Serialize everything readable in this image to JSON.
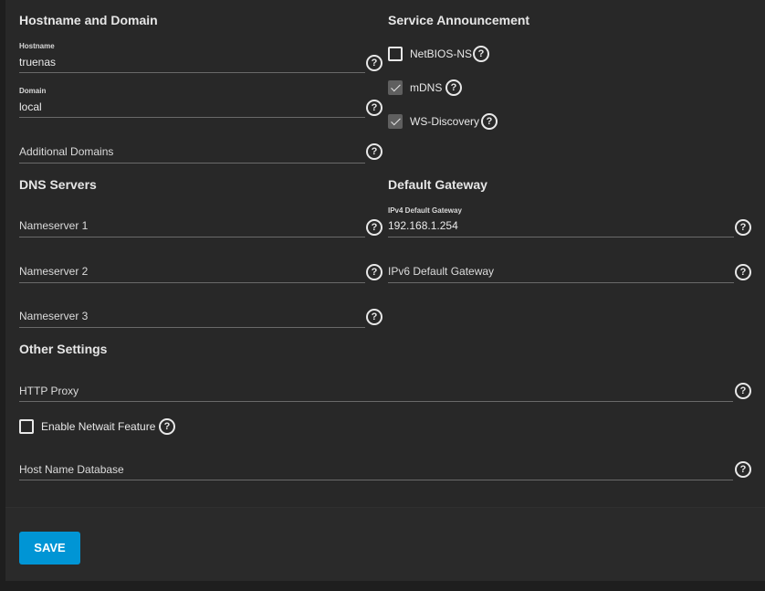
{
  "sections": {
    "hostname_domain": "Hostname and Domain",
    "service_announcement": "Service Announcement",
    "dns_servers": "DNS Servers",
    "default_gateway": "Default Gateway",
    "other_settings": "Other Settings"
  },
  "hostname": {
    "label": "Hostname",
    "value": "truenas"
  },
  "domain": {
    "label": "Domain",
    "value": "local"
  },
  "additional_domains": {
    "placeholder": "Additional Domains"
  },
  "nameserver1": {
    "placeholder": "Nameserver 1"
  },
  "nameserver2": {
    "placeholder": "Nameserver 2"
  },
  "nameserver3": {
    "placeholder": "Nameserver 3"
  },
  "service": {
    "netbios": {
      "label": "NetBIOS-NS",
      "checked": false
    },
    "mdns": {
      "label": "mDNS",
      "checked": true
    },
    "wsd": {
      "label": "WS-Discovery",
      "checked": true
    }
  },
  "ipv4_gateway": {
    "label": "IPv4 Default Gateway",
    "value": "192.168.1.254"
  },
  "ipv6_gateway": {
    "placeholder": "IPv6 Default Gateway"
  },
  "http_proxy": {
    "placeholder": "HTTP Proxy"
  },
  "netwait": {
    "label": "Enable Netwait Feature",
    "checked": false
  },
  "host_name_database": {
    "placeholder": "Host Name Database"
  },
  "help_glyph": "?",
  "save_label": "SAVE",
  "colors": {
    "accent": "#0095d5",
    "background": "#282828"
  }
}
